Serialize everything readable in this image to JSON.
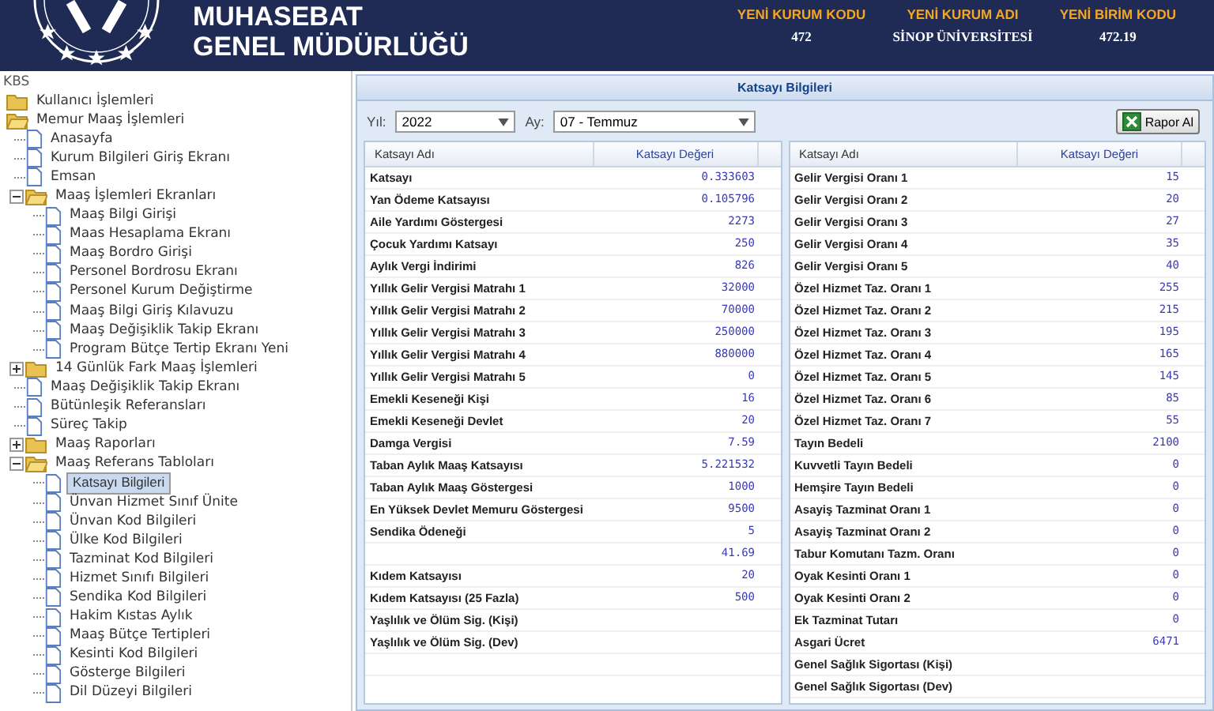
{
  "header": {
    "title_lines": [
      "MUHASEBAT",
      "GENEL MÜDÜRLÜĞÜ"
    ],
    "info": [
      {
        "label": "YENİ KURUM KODU",
        "value": "472"
      },
      {
        "label": "YENİ KURUM ADI",
        "value": "SİNOP ÜNİVERSİTESİ"
      },
      {
        "label": "YENİ BİRİM KODU",
        "value": "472.19"
      }
    ]
  },
  "sidebar": {
    "root": "KBS",
    "tree": [
      {
        "label": "Kullanıcı İşlemleri",
        "kind": "folder",
        "expanded": false,
        "selected": false
      },
      {
        "label": "Memur Maaş İşlemleri",
        "kind": "folder",
        "expanded": true,
        "selected": false,
        "children": [
          {
            "label": "Anasayfa",
            "kind": "page",
            "selected": false
          },
          {
            "label": "Kurum Bilgileri Giriş Ekranı",
            "kind": "page",
            "selected": false
          },
          {
            "label": "Emsan",
            "kind": "page",
            "selected": false
          },
          {
            "label": "Maaş İşlemleri Ekranları",
            "kind": "folder",
            "expanded": true,
            "selected": false,
            "children": [
              {
                "label": "Maaş Bilgi Girişi",
                "kind": "page",
                "selected": false
              },
              {
                "label": "Maas Hesaplama Ekranı",
                "kind": "page",
                "selected": false
              },
              {
                "label": "Maaş Bordro Girişi",
                "kind": "page",
                "selected": false
              },
              {
                "label": "Personel Bordrosu Ekranı",
                "kind": "page",
                "selected": false
              },
              {
                "label": "Personel Kurum Değiştirme",
                "kind": "page",
                "selected": false
              },
              {
                "label": "Maaş Bilgi Giriş Kılavuzu",
                "kind": "page",
                "selected": false
              },
              {
                "label": "Maaş Değişiklik Takip Ekranı",
                "kind": "page",
                "selected": false
              },
              {
                "label": "Program Bütçe Tertip Ekranı Yeni",
                "kind": "page",
                "selected": false
              }
            ]
          },
          {
            "label": "14 Günlük Fark Maaş İşlemleri",
            "kind": "folder",
            "expanded": false,
            "selected": false
          },
          {
            "label": "Maaş Değişiklik Takip Ekranı",
            "kind": "page",
            "selected": false
          },
          {
            "label": "Bütünleşik Referansları",
            "kind": "page",
            "selected": false
          },
          {
            "label": "Süreç Takip",
            "kind": "page",
            "selected": false
          },
          {
            "label": "Maaş Raporları",
            "kind": "folder",
            "expanded": false,
            "selected": false
          },
          {
            "label": "Maaş Referans Tabloları",
            "kind": "folder",
            "expanded": true,
            "selected": false,
            "children": [
              {
                "label": "Katsayı Bilgileri",
                "kind": "page",
                "selected": true
              },
              {
                "label": "Ünvan Hizmet Sınıf Ünite",
                "kind": "page",
                "selected": false
              },
              {
                "label": "Ünvan Kod Bilgileri",
                "kind": "page",
                "selected": false
              },
              {
                "label": "Ülke Kod Bilgileri",
                "kind": "page",
                "selected": false
              },
              {
                "label": "Tazminat Kod Bilgileri",
                "kind": "page",
                "selected": false
              },
              {
                "label": "Hizmet Sınıfı Bilgileri",
                "kind": "page",
                "selected": false
              },
              {
                "label": "Sendika Kod Bilgileri",
                "kind": "page",
                "selected": false
              },
              {
                "label": "Hakim Kıstas Aylık",
                "kind": "page",
                "selected": false
              },
              {
                "label": "Maaş Bütçe Tertipleri",
                "kind": "page",
                "selected": false
              },
              {
                "label": "Kesinti Kod Bilgileri",
                "kind": "page",
                "selected": false
              },
              {
                "label": "Gösterge Bilgileri",
                "kind": "page",
                "selected": false
              },
              {
                "label": "Dil Düzeyi Bilgileri",
                "kind": "page",
                "selected": false
              }
            ]
          }
        ]
      }
    ]
  },
  "panel": {
    "title": "Katsayı Bilgileri",
    "year": {
      "label": "Yıl:",
      "value": "2022"
    },
    "month": {
      "label": "Ay:",
      "value": "07 - Temmuz"
    },
    "report_button": "Rapor Al",
    "tables": [
      {
        "columns": [
          "Katsayı Adı",
          "Katsayı Değeri"
        ],
        "rows": [
          {
            "name": "Katsayı",
            "value": "0.333603"
          },
          {
            "name": "Yan Ödeme Katsayısı",
            "value": "0.105796"
          },
          {
            "name": "Aile Yardımı Göstergesi",
            "value": "2273"
          },
          {
            "name": "Çocuk Yardımı Katsayı",
            "value": "250"
          },
          {
            "name": "Aylık Vergi İndirimi",
            "value": "826"
          },
          {
            "name": "Yıllık Gelir Vergisi Matrahı 1",
            "value": "32000"
          },
          {
            "name": "Yıllık Gelir Vergisi Matrahı 2",
            "value": "70000"
          },
          {
            "name": "Yıllık Gelir Vergisi Matrahı 3",
            "value": "250000"
          },
          {
            "name": "Yıllık Gelir Vergisi Matrahı 4",
            "value": "880000"
          },
          {
            "name": "Yıllık Gelir Vergisi Matrahı 5",
            "value": "0"
          },
          {
            "name": "Emekli Keseneği Kişi",
            "value": "16"
          },
          {
            "name": "Emekli Keseneği Devlet",
            "value": "20"
          },
          {
            "name": "Damga Vergisi",
            "value": "7.59"
          },
          {
            "name": "Taban Aylık Maaş Katsayısı",
            "value": "5.221532"
          },
          {
            "name": "Taban Aylık Maaş Göstergesi",
            "value": "1000"
          },
          {
            "name": "En Yüksek Devlet Memuru Göstergesi",
            "value": "9500"
          },
          {
            "name": "Sendika Ödeneği",
            "value": "5"
          },
          {
            "value": "41.69"
          },
          {
            "name": "Kıdem Katsayısı",
            "value": "20"
          },
          {
            "name": "Kıdem Katsayısı (25 Fazla)",
            "value": "500"
          },
          {
            "name": "Yaşlılık ve Ölüm Sig. (Kişi)"
          },
          {
            "name": "Yaşlılık ve Ölüm Sig. (Dev)"
          }
        ]
      },
      {
        "columns": [
          "Katsayı Adı",
          "Katsayı Değeri"
        ],
        "rows": [
          {
            "name": "Gelir Vergisi Oranı 1",
            "value": "15"
          },
          {
            "name": "Gelir Vergisi Oranı 2",
            "value": "20"
          },
          {
            "name": "Gelir Vergisi Oranı 3",
            "value": "27"
          },
          {
            "name": "Gelir Vergisi Oranı 4",
            "value": "35"
          },
          {
            "name": "Gelir Vergisi Oranı 5",
            "value": "40"
          },
          {
            "name": "Özel Hizmet Taz. Oranı 1",
            "value": "255"
          },
          {
            "name": "Özel Hizmet Taz. Oranı 2",
            "value": "215"
          },
          {
            "name": "Özel Hizmet Taz. Oranı 3",
            "value": "195"
          },
          {
            "name": "Özel Hizmet Taz. Oranı 4",
            "value": "165"
          },
          {
            "name": "Özel Hizmet Taz. Oranı 5",
            "value": "145"
          },
          {
            "name": "Özel Hizmet Taz. Oranı 6",
            "value": "85"
          },
          {
            "name": "Özel Hizmet Taz. Oranı 7",
            "value": "55"
          },
          {
            "name": "Tayın Bedeli",
            "value": "2100"
          },
          {
            "name": "Kuvvetli Tayın Bedeli",
            "value": "0"
          },
          {
            "name": "Hemşire Tayın Bedeli",
            "value": "0"
          },
          {
            "name": "Asayiş Tazminat Oranı 1",
            "value": "0"
          },
          {
            "name": "Asayiş Tazminat Oranı 2",
            "value": "0"
          },
          {
            "name": "Tabur Komutanı Tazm. Oranı",
            "value": "0"
          },
          {
            "name": "Oyak Kesinti Oranı 1",
            "value": "0"
          },
          {
            "name": "Oyak Kesinti Oranı 2",
            "value": "0"
          },
          {
            "name": "Ek Tazminat Tutarı",
            "value": "0"
          },
          {
            "name": "Asgari Ücret",
            "value": "6471"
          },
          {
            "name": "Genel Sağlık Sigortası (Kişi)"
          },
          {
            "name": "Genel Sağlık Sigortası (Dev)"
          }
        ]
      }
    ]
  }
}
